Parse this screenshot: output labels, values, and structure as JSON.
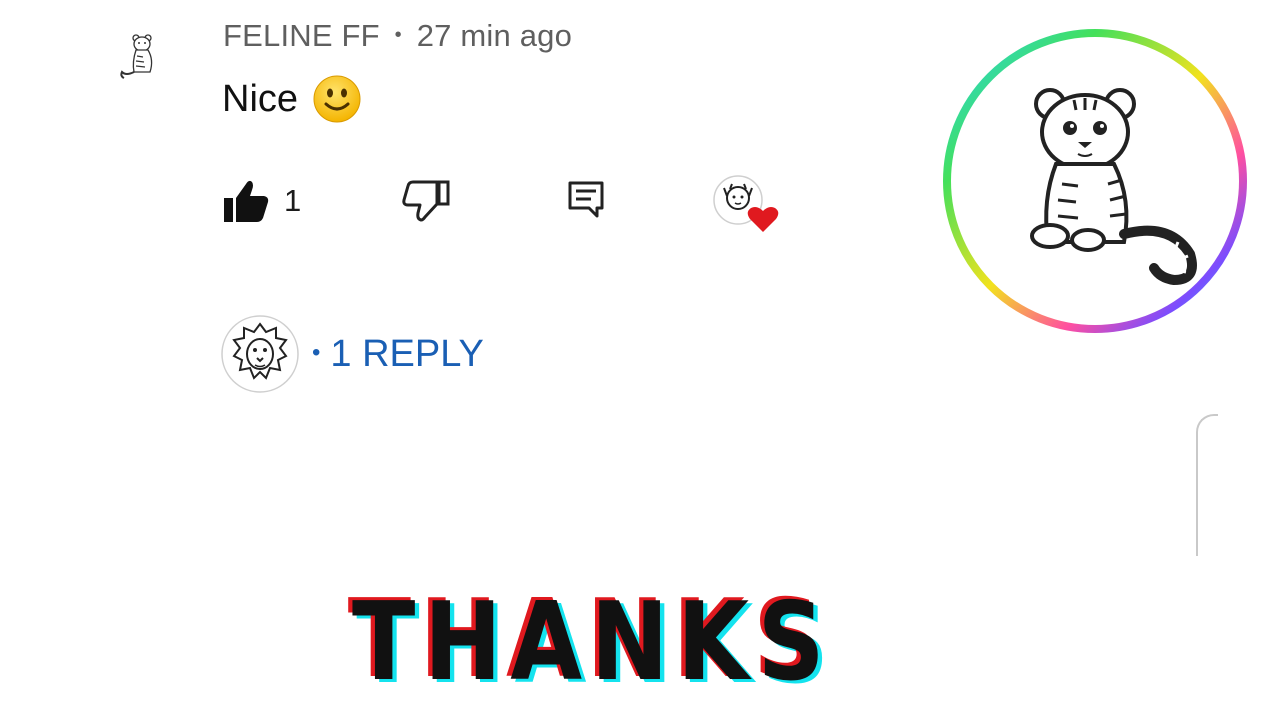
{
  "comment": {
    "author": "FELINE FF",
    "separator": "•",
    "time": "27 min ago",
    "text": "Nice",
    "emoji": "slightly-smiling-face-icon"
  },
  "actions": {
    "like_count": "1",
    "like_icon": "thumbs-up-icon",
    "dislike_icon": "thumbs-down-icon",
    "reply_icon": "comment-icon",
    "creator_heart": "creator-heart-icon"
  },
  "replies": {
    "dot": "•",
    "label": "1 REPLY"
  },
  "banner": {
    "text": "THANKS"
  },
  "colors": {
    "reply_link": "#1a5fb4",
    "heart": "#e0191f",
    "glitch_red": "#e0191f",
    "glitch_cyan": "#14e3ee"
  }
}
